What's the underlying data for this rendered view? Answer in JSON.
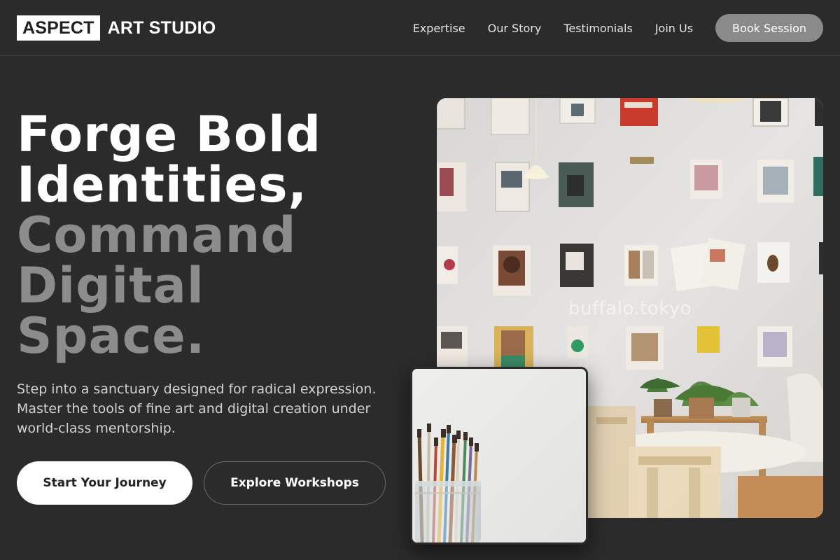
{
  "header": {
    "logo_box": "ASPECT",
    "logo_text": "ART STUDIO",
    "nav": [
      "Expertise",
      "Our Story",
      "Testimonials",
      "Join Us"
    ],
    "cta": "Book Session"
  },
  "hero": {
    "title_lines": [
      "Forge Bold",
      "Identities,",
      "Command",
      "Digital",
      "Space."
    ],
    "subtitle": "Step into a sanctuary designed for radical expression. Master the tools of fine art and digital creation under world-class mentorship.",
    "primary_cta": "Start Your Journey",
    "secondary_cta": "Explore Workshops"
  },
  "images": {
    "main_watermark": "buffalo.tokyo"
  }
}
